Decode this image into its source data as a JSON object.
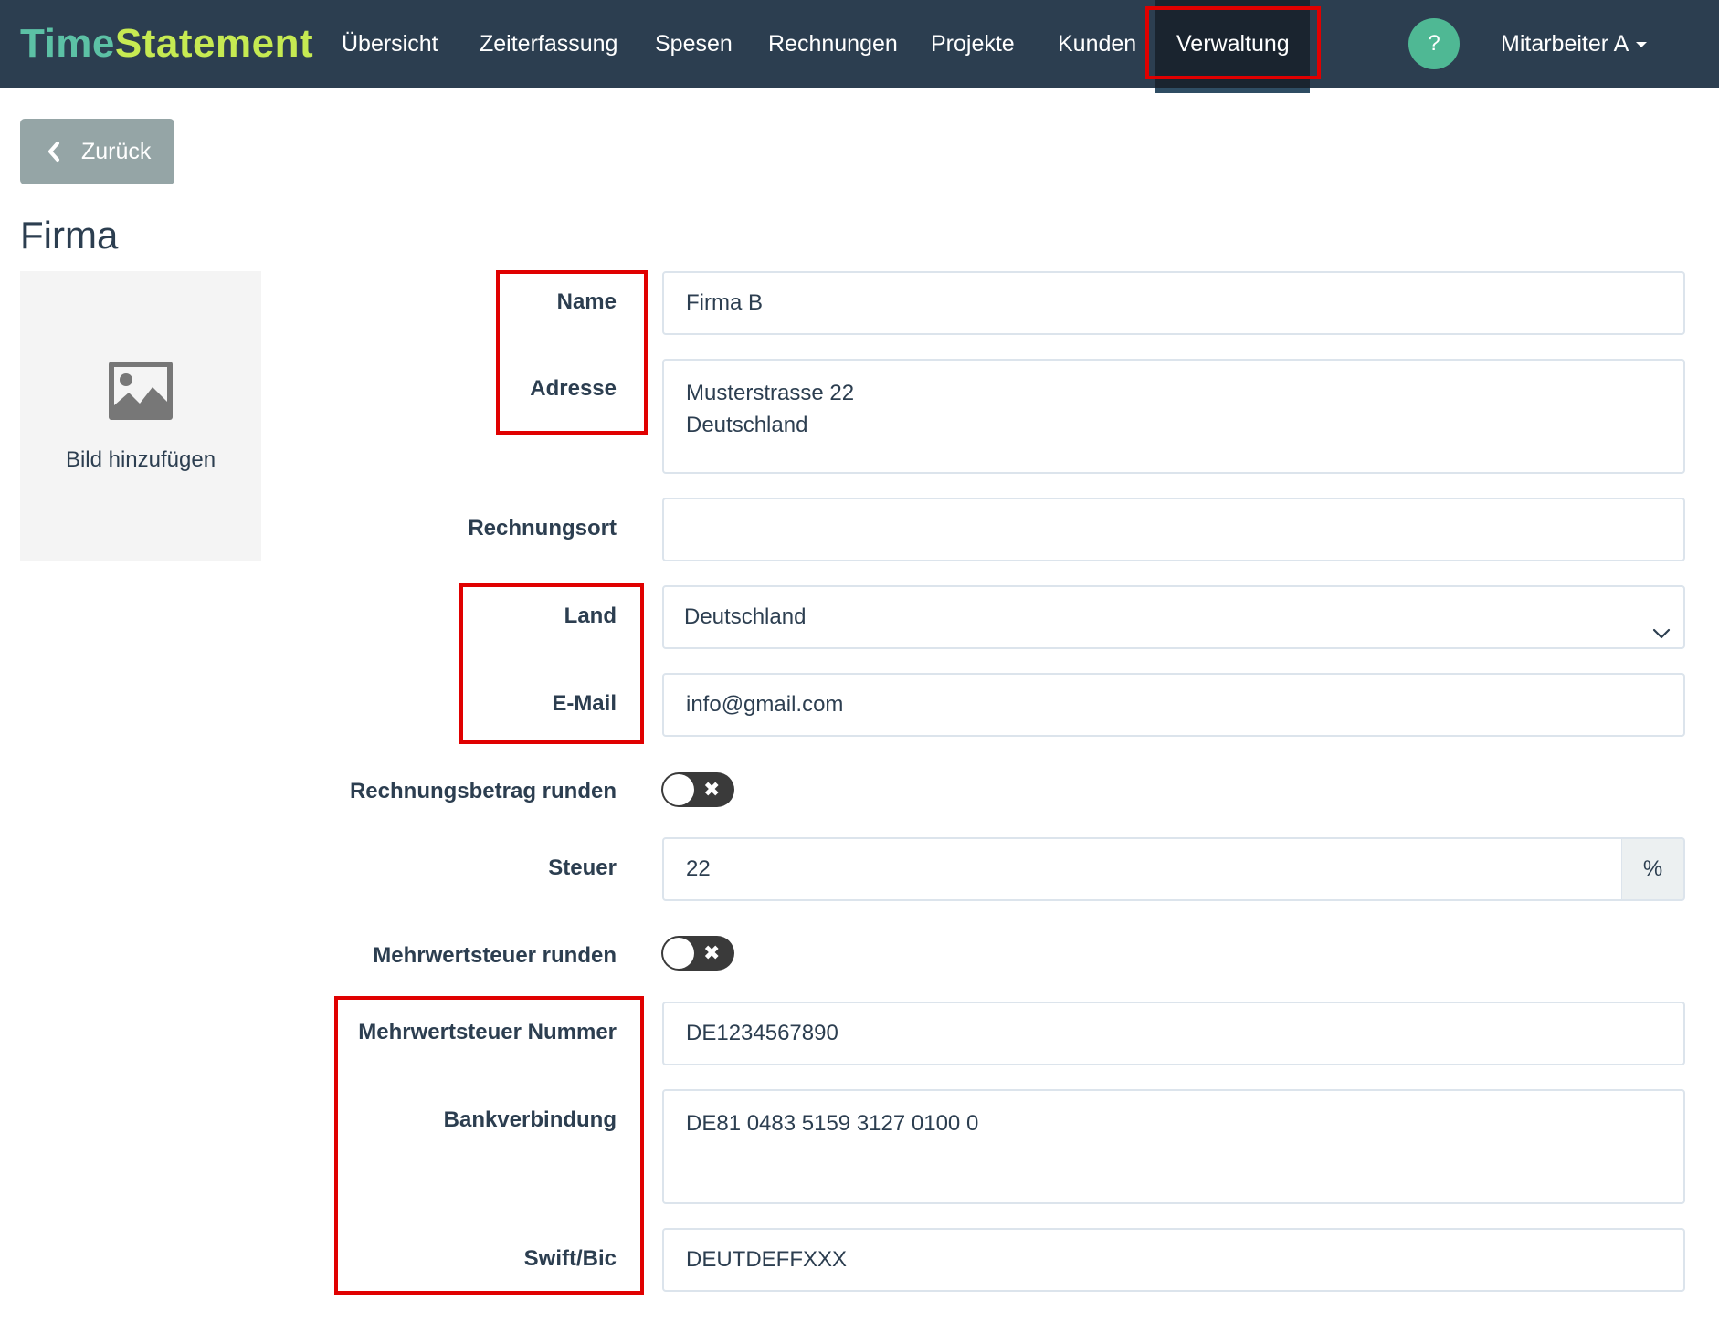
{
  "brand": {
    "part1": "Time",
    "part2": "Statement"
  },
  "nav": {
    "items": [
      "Übersicht",
      "Zeiterfassung",
      "Spesen",
      "Rechnungen",
      "Projekte",
      "Kunden",
      "Verwaltung"
    ],
    "active": "Verwaltung",
    "help_label": "?",
    "user_label": "Mitarbeiter A"
  },
  "back_button": {
    "label": "Zurück"
  },
  "page_title": "Firma",
  "image_upload": {
    "label": "Bild hinzufügen"
  },
  "form": {
    "name": {
      "label": "Name",
      "value": "Firma B"
    },
    "adresse": {
      "label": "Adresse",
      "value": "Musterstrasse 22\nDeutschland"
    },
    "rechnungsort": {
      "label": "Rechnungsort",
      "value": ""
    },
    "land": {
      "label": "Land",
      "value": "Deutschland"
    },
    "email": {
      "label": "E-Mail",
      "value": "info@gmail.com"
    },
    "rechnungsbetrag_runden": {
      "label": "Rechnungsbetrag runden",
      "state": "off",
      "off_glyph": "✖"
    },
    "steuer": {
      "label": "Steuer",
      "value": "22",
      "unit": "%"
    },
    "mehrwertsteuer_runden": {
      "label": "Mehrwertsteuer runden",
      "state": "off",
      "off_glyph": "✖"
    },
    "mwst_nummer": {
      "label": "Mehrwertsteuer Nummer",
      "value": "DE1234567890"
    },
    "bankverbindung": {
      "label": "Bankverbindung",
      "value": "DE81 0483 5159 3127 0100 0"
    },
    "swift_bic": {
      "label": "Swift/Bic",
      "value": "DEUTDEFFXXX"
    }
  },
  "colors": {
    "navbar": "#2c3e50",
    "brand_time": "#5cc1a5",
    "brand_statement": "#c6ea52",
    "help_button": "#4fb894",
    "highlight": "#e00000",
    "back_button": "#95a5a6"
  },
  "icons": {
    "back": "chevron-left-icon",
    "image": "image-icon",
    "select": "chevron-down-icon",
    "caret": "caret-down-icon"
  }
}
